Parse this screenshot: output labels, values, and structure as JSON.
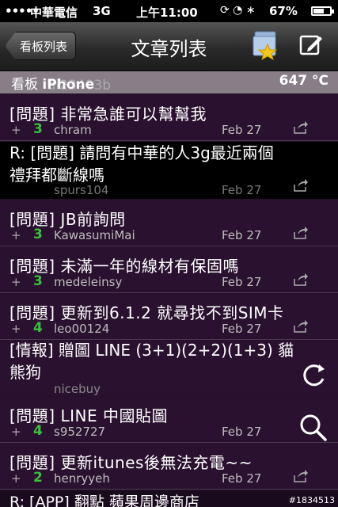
{
  "status_bar": {
    "signal": "•••••",
    "carrier": "中華電信",
    "network": "3G",
    "time": "上午11:00",
    "icons": "⟳ ◔ ∗",
    "battery_percent": "67%",
    "battery_level": 0.67
  },
  "nav": {
    "back_label": "看板列表",
    "title": "文章列表"
  },
  "board": {
    "label": "看板",
    "name": "iPhone",
    "count": "647 °C",
    "ghost_text": "ai23403b"
  },
  "rows": [
    {
      "title": "[問題] 非常急誰可以幫幫我",
      "count": "3",
      "author": "chram",
      "date": "Feb 27",
      "style": "normal"
    },
    {
      "title": "[問題] JB前詢問",
      "count": "3",
      "author": "KawasumiMai",
      "date": "Feb 27",
      "style": "normal"
    },
    {
      "title": "[問題] 未滿一年的線材有保固嗎",
      "count": "3",
      "author": "medeleinsy",
      "date": "Feb 27",
      "style": "normal"
    },
    {
      "title": "[問題] 更新到6.1.2 就尋找不到SIM卡",
      "count": "4",
      "author": "leo00124",
      "date": "Feb 27",
      "style": "normal"
    },
    {
      "title": "[問題] LINE 中國貼圖",
      "count": "4",
      "author": "s952727",
      "date": "Feb 27",
      "style": "normal"
    },
    {
      "title": "[問題] 更新itunes後無法充電~~",
      "count": "2",
      "author": "henryyeh",
      "date": "Feb 27",
      "style": "normal"
    }
  ],
  "overlap_rows": [
    {
      "line1": "R: [問題] 請問有中華的人3g最近兩個",
      "line2": "禮拜都斷線嗎",
      "author": "spurs104",
      "date": "Feb 27"
    },
    {
      "line1": "[情報] 贈圖 LINE (3+1)(2+2)(1+3) 貓",
      "line2": "熊狗",
      "author": "nicebuy",
      "date": "Feb 27"
    }
  ],
  "bottom_partial": "R: [APP] 翻點 蘋果周邊商店",
  "watermark": "#1834513"
}
